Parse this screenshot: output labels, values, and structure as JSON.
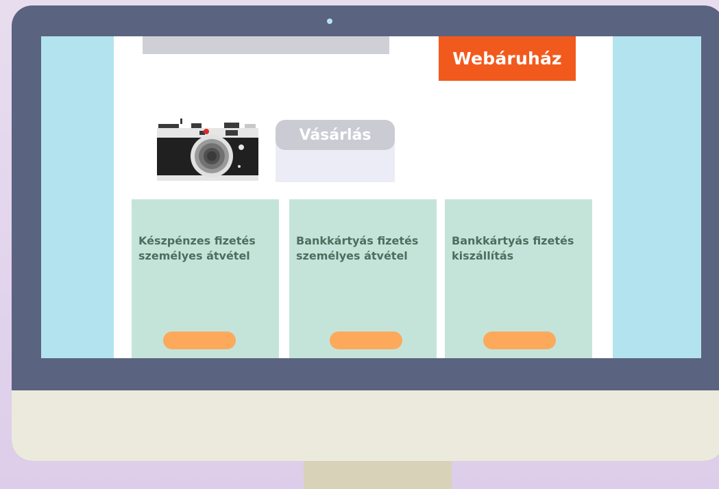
{
  "header": {
    "brand": "Webáruház"
  },
  "hero": {
    "purchase_title": "Vásárlás"
  },
  "payment_options": [
    {
      "title": "Készpénzes fizetés\nszemélyes átvétel"
    },
    {
      "title": "Bankkártyás fizetés\nszemélyes átvétel"
    },
    {
      "title": "Bankkártyás fizetés\nkiszállítás"
    }
  ],
  "icons": {
    "product": "camera-icon",
    "webcam": "webcam-dot"
  },
  "colors": {
    "brand_orange": "#f25a1d",
    "card_green": "#c5e4d9",
    "card_text": "#4e6d5f",
    "button_orange": "#fca95c",
    "screen_bg": "#b3e3ee",
    "bezel": "#5a6380"
  }
}
